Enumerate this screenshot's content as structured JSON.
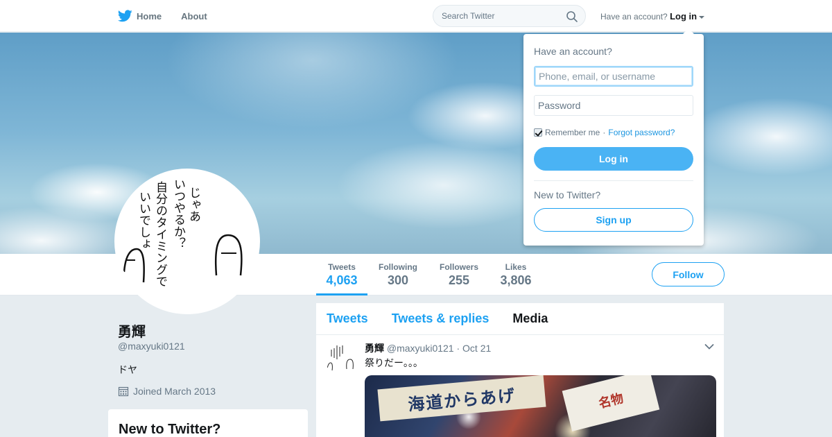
{
  "nav": {
    "home": "Home",
    "about": "About",
    "search_placeholder": "Search Twitter",
    "have_account": "Have an account?",
    "login": "Log in"
  },
  "profile": {
    "name": "勇輝",
    "handle": "@maxyuki0121",
    "bio": "ドヤ",
    "joined": "Joined March 2013",
    "avatar_text_lines": [
      "じゃあ",
      "いつやるか？",
      "自分のタイミングで",
      "いいでしょ"
    ]
  },
  "stats": [
    {
      "label": "Tweets",
      "value": "4,063"
    },
    {
      "label": "Following",
      "value": "300"
    },
    {
      "label": "Followers",
      "value": "255"
    },
    {
      "label": "Likes",
      "value": "3,806"
    }
  ],
  "follow_label": "Follow",
  "timeline": {
    "tabs": [
      "Tweets",
      "Tweets & replies",
      "Media"
    ],
    "tweet": {
      "name": "勇輝",
      "handle": "@maxyuki0121",
      "date": "· Oct 21",
      "text": "祭りだー。。。",
      "media_sign": "海道からあげ",
      "media_sign2": "名物"
    }
  },
  "new_to_twitter_card": "New to Twitter?",
  "login_dropdown": {
    "title": "Have an account?",
    "username_placeholder": "Phone, email, or username",
    "password_placeholder": "Password",
    "remember": "Remember me",
    "separator": "·",
    "forgot": "Forgot password?",
    "login_button": "Log in",
    "new_prompt": "New to Twitter?",
    "signup_button": "Sign up"
  },
  "colors": {
    "accent": "#1da1f2",
    "login_button": "#4ab3f4",
    "background": "#e6ecf0"
  }
}
